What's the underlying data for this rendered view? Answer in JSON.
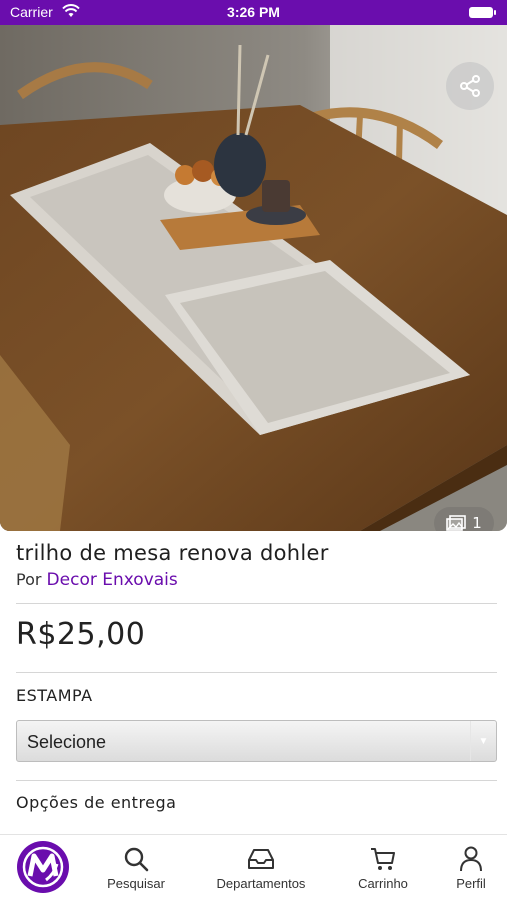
{
  "status_bar": {
    "carrier": "Carrier",
    "time": "3:26 PM"
  },
  "product": {
    "title": "trilho de mesa renova dohler",
    "seller_prefix": "Por",
    "seller_name": "Decor Enxovais",
    "price": "R$25,00",
    "photo_count": "1",
    "icons": {
      "share": "share-icon",
      "photos": "gallery-icon"
    }
  },
  "variant": {
    "label": "ESTAMPA",
    "select_value": "Selecione"
  },
  "delivery": {
    "label": "Opções de entrega"
  },
  "tab_bar": {
    "items": [
      {
        "label": "",
        "icon": "brand-logo-icon"
      },
      {
        "label": "Pesquisar",
        "icon": "search-icon"
      },
      {
        "label": "Departamentos",
        "icon": "inbox-icon"
      },
      {
        "label": "Carrinho",
        "icon": "cart-icon"
      },
      {
        "label": "Perfil",
        "icon": "user-icon"
      }
    ]
  },
  "colors": {
    "accent": "#6a0dad",
    "status_bar": "#6a0dad"
  }
}
